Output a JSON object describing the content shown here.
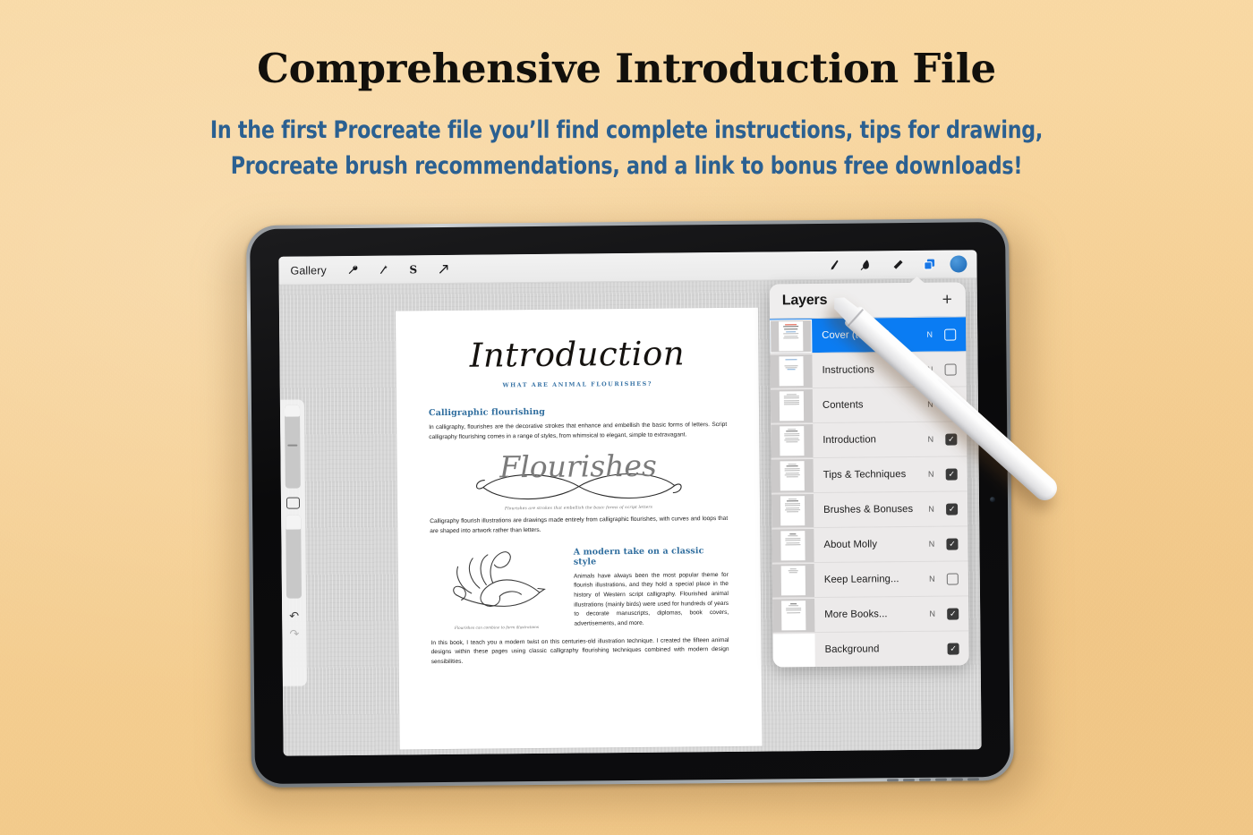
{
  "background_color": "#f7d59c",
  "headings": {
    "title": "Comprehensive Introduction File",
    "title_color": "#12100c",
    "subtitle_color": "#2b6091",
    "subtitle_line1": "In the first Procreate file you’ll find complete instructions, tips for drawing,",
    "subtitle_line2": "Procreate brush recommendations, and a link to bonus free downloads!"
  },
  "procreate": {
    "topbar": {
      "gallery_label": "Gallery",
      "left_tools": [
        {
          "name": "actions-wrench-icon",
          "glyph": "🔧"
        },
        {
          "name": "adjustments-icon",
          "glyph": "✂"
        },
        {
          "name": "selection-s-icon",
          "glyph": "S"
        },
        {
          "name": "transform-arrow-icon",
          "glyph": "↗"
        }
      ],
      "right_tools": [
        {
          "name": "paint-brush-icon",
          "glyph": "╱"
        },
        {
          "name": "smudge-icon",
          "glyph": "◣"
        },
        {
          "name": "eraser-icon",
          "glyph": "▰"
        },
        {
          "name": "layers-icon",
          "glyph": "❐"
        }
      ],
      "color_swatch": "#2a76c0"
    },
    "sidebar": {
      "brush_size_label": "brush-size-slider",
      "modify_label": "modify-button",
      "opacity_label": "opacity-slider",
      "undo_glyph": "↶",
      "redo_glyph": "↷"
    },
    "layers_panel": {
      "title": "Layers",
      "add_glyph": "+",
      "selected_color": "#0a7cf3",
      "layers": [
        {
          "name": "Cover (turn off)",
          "blend": "N",
          "visible": false,
          "selected": true,
          "thumb": "cover"
        },
        {
          "name": "Instructions",
          "blend": "N",
          "visible": false,
          "selected": false,
          "thumb": "instructions"
        },
        {
          "name": "Contents",
          "blend": "N",
          "visible": false,
          "selected": false,
          "thumb": "contents"
        },
        {
          "name": "Introduction",
          "blend": "N",
          "visible": true,
          "selected": false,
          "thumb": "text"
        },
        {
          "name": "Tips & Techniques",
          "blend": "N",
          "visible": true,
          "selected": false,
          "thumb": "text"
        },
        {
          "name": "Brushes & Bonuses",
          "blend": "N",
          "visible": true,
          "selected": false,
          "thumb": "text"
        },
        {
          "name": "About Molly",
          "blend": "N",
          "visible": true,
          "selected": false,
          "thumb": "portrait"
        },
        {
          "name": "Keep Learning...",
          "blend": "N",
          "visible": false,
          "selected": false,
          "thumb": "circle"
        },
        {
          "name": "More Books...",
          "blend": "N",
          "visible": true,
          "selected": false,
          "thumb": "book"
        },
        {
          "name": "Background",
          "blend": "",
          "visible": true,
          "selected": false,
          "thumb": "blank"
        }
      ]
    },
    "document": {
      "title": "Introduction",
      "kicker": "WHAT ARE ANIMAL FLOURISHES?",
      "heading1": "Calligraphic flourishing",
      "para1": "In calligraphy, flourishes are the decorative strokes that enhance and embellish the basic forms of letters. Script calligraphy flourishing comes in a range of styles, from whimsical to elegant, simple to extravagant.",
      "script_word": "Flourishes",
      "caption1": "Flourishes are strokes that embellish the basic forms of script letters",
      "para2": "Calligraphy flourish illustrations are drawings made entirely from calligraphic flourishes, with curves and loops that are shaped into artwork rather than letters.",
      "heading2": "A modern take on a classic style",
      "para3": "Animals have always been the most popular theme for flourish illustrations, and they hold a special place in the history of Western script calligraphy. Flourished animal illustrations (mainly birds) were used for hundreds of years to decorate manuscripts, diplomas, book covers, advertisements, and more.",
      "caption2": "Flourishes can combine to form illustrations",
      "para4": "In this book, I teach you a modern twist on this centuries-old illustration technique. I created the fifteen animal designs within these pages using classic calligraphy flourishing techniques combined with modern design sensibilities."
    }
  }
}
